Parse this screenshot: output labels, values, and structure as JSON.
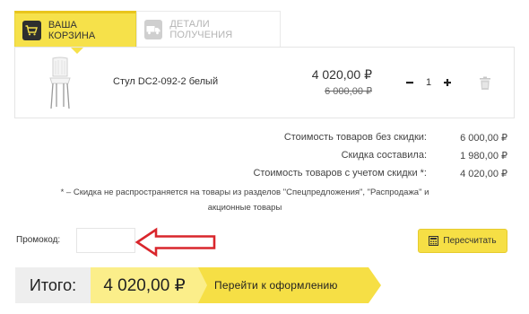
{
  "tabs": [
    {
      "label": "ВАША КОРЗИНА",
      "icon": "cart-icon",
      "active": true
    },
    {
      "label": "ДЕТАЛИ ПОЛУЧЕНИЯ",
      "icon": "truck-icon",
      "active": false
    }
  ],
  "cart": {
    "items": [
      {
        "name": "Стул DC2-092-2 белый",
        "price": "4 020,00 ₽",
        "old_price": "6 000,00 ₽",
        "quantity": "1",
        "image": "white-chair-image",
        "delete_icon": "trash-icon"
      }
    ]
  },
  "summary": {
    "rows": [
      {
        "label": "Стоимость товаров без скидки:",
        "value": "6 000,00 ₽"
      },
      {
        "label": "Скидка составила:",
        "value": "1 980,00 ₽"
      },
      {
        "label": "Стоимость товаров с учетом скидки *:",
        "value": "4 020,00 ₽"
      }
    ],
    "footnote_line1": "* – Скидка не распространяется на товары из разделов \"Спецпредложения\", \"Распродажа\" и",
    "footnote_line2": "акционные товары"
  },
  "promo": {
    "label": "Промокод:",
    "value": "",
    "placeholder": "",
    "annotation": "red-arrow-pointing-left"
  },
  "recalc_button": {
    "label": "Пересчитать",
    "icon": "calculator-icon"
  },
  "total": {
    "label": "Итого:",
    "value": "4 020,00 ₽",
    "checkout_label": "Перейти к оформлению"
  },
  "colors": {
    "accent_yellow": "#f6e14a",
    "total_value_bg": "#fbee8a",
    "annotation_red": "#d9262c"
  }
}
